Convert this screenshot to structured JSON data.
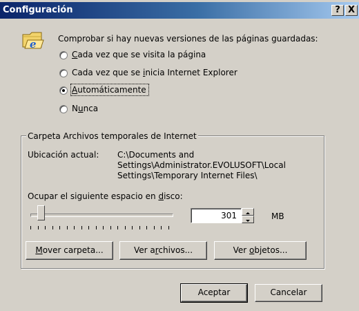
{
  "window": {
    "title": "Configuración",
    "help_button": "?",
    "close_button": "X"
  },
  "check_section": {
    "prompt": "Comprobar si hay nuevas versiones de las páginas guardadas:",
    "options": [
      {
        "pre": "",
        "accel": "C",
        "post": "ada vez que se visita la página",
        "selected": false
      },
      {
        "pre": "Cada vez que se ",
        "accel": "i",
        "post": "nicia Internet Explorer",
        "selected": false
      },
      {
        "pre": "",
        "accel": "A",
        "post": "utomáticamente",
        "selected": true
      },
      {
        "pre": "N",
        "accel": "u",
        "post": "nca",
        "selected": false
      }
    ]
  },
  "temp_folder": {
    "group_title": "Carpeta Archivos temporales de Internet",
    "location_label": "Ubicación actual:",
    "location_lines": [
      "C:\\Documents and",
      "Settings\\Administrator.EVOLUSOFT\\Local",
      "Settings\\Temporary Internet Files\\"
    ],
    "disk_label_pre": "Ocupar el siguiente espacio en ",
    "disk_label_accel": "d",
    "disk_label_post": "isco:",
    "slider_fraction": 0.05,
    "size_value": "301",
    "size_unit": "MB",
    "buttons": {
      "move": {
        "pre": "",
        "accel": "M",
        "post": "over carpeta..."
      },
      "files": {
        "pre": "Ver a",
        "accel": "r",
        "post": "chivos..."
      },
      "objects": {
        "pre": "Ver ",
        "accel": "o",
        "post": "bjetos..."
      }
    }
  },
  "footer": {
    "ok_label": "Aceptar",
    "cancel_label": "Cancelar"
  },
  "icons": {
    "app_icon": "internet-explorer-folder-icon"
  }
}
